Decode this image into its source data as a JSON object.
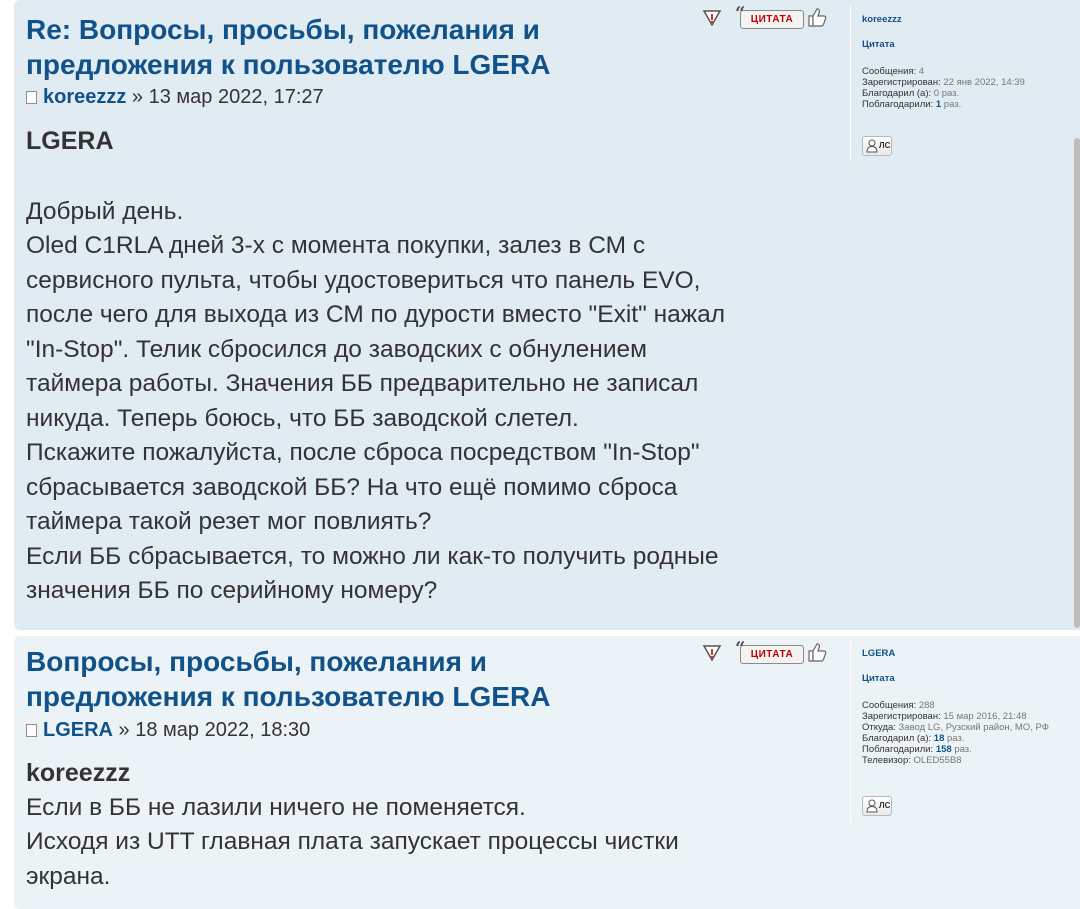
{
  "posts": [
    {
      "title_line1": "Re: Вопросы, просьбы, пожелания и",
      "title_line2": "предложения к пользователю LGERA",
      "author": "koreezzz",
      "date": " » 13 мар 2022, 17:27",
      "quote_name": "LGERA",
      "paragraphs": [
        "Добрый день.",
        "Oled C1RLA дней 3-х с момента покупки, залез в СМ с",
        "сервисного пульта, чтобы удостовериться что панель EVO,",
        "после чего для выхода из СМ по дурости вместо \"Exit\" нажал",
        "\"In-Stop\". Телик сбросился до заводских с обнулением",
        "таймера работы. Значения ББ предварительно не записал",
        "никуда. Теперь боюсь, что ББ заводской слетел.",
        "Пскажите пожалуйста, после сброса посредством \"In-Stop\"",
        "сбрасывается заводской ББ? На что ещё помимо сброса",
        "таймера такой резет мог повлиять?",
        "Если ББ сбрасывается, то можно ли как-то получить родные",
        "значения ББ по серийному номеру?"
      ],
      "quote_button": "ЦИТАТА",
      "profile": {
        "username": "koreezzz",
        "rank": "Цитата",
        "messages_label": "Сообщения: ",
        "messages": "4",
        "registered_label": "Зарегистрирован: ",
        "registered": "22 янв 2022, 14:39",
        "thanked_label": "Благодарил (а): ",
        "thanked": "0 раз.",
        "got_thanks_label": "Поблагодарили: ",
        "got_thanks_num": "1",
        "got_thanks_suffix": " раз.",
        "pm_label": "ЛС"
      }
    },
    {
      "title_line1": "Вопросы, просьбы, пожелания и",
      "title_line2": "предложения к пользователю LGERA",
      "author": "LGERA",
      "date": " » 18 мар 2022, 18:30",
      "quote_name": "koreezzz",
      "paragraphs": [
        "Если в ББ не лазили ничего не поменяется.",
        "Исходя из UTT главная плата запускает процессы чистки",
        "экрана."
      ],
      "quote_button": "ЦИТАТА",
      "profile": {
        "username": "LGERA",
        "rank": "Цитата",
        "messages_label": "Сообщения: ",
        "messages": "288",
        "registered_label": "Зарегистрирован: ",
        "registered": "15 мар 2016, 21:48",
        "from_label": "Откуда: ",
        "from": "Завод LG, Рузский район, МО, РФ",
        "thanked_label": "Благодарил (а): ",
        "thanked_num": "18",
        "thanked_suffix": " раз.",
        "got_thanks_label": "Поблагодарили: ",
        "got_thanks_num": "158",
        "got_thanks_suffix": " раз.",
        "tv_label": "Телевизор: ",
        "tv": "OLED55B8",
        "pm_label": "ЛС"
      }
    }
  ],
  "colors": {
    "post_bg_1": "#e1ebf2",
    "post_bg_2": "#ecf3f7",
    "link": "#105289",
    "text": "#333333"
  }
}
